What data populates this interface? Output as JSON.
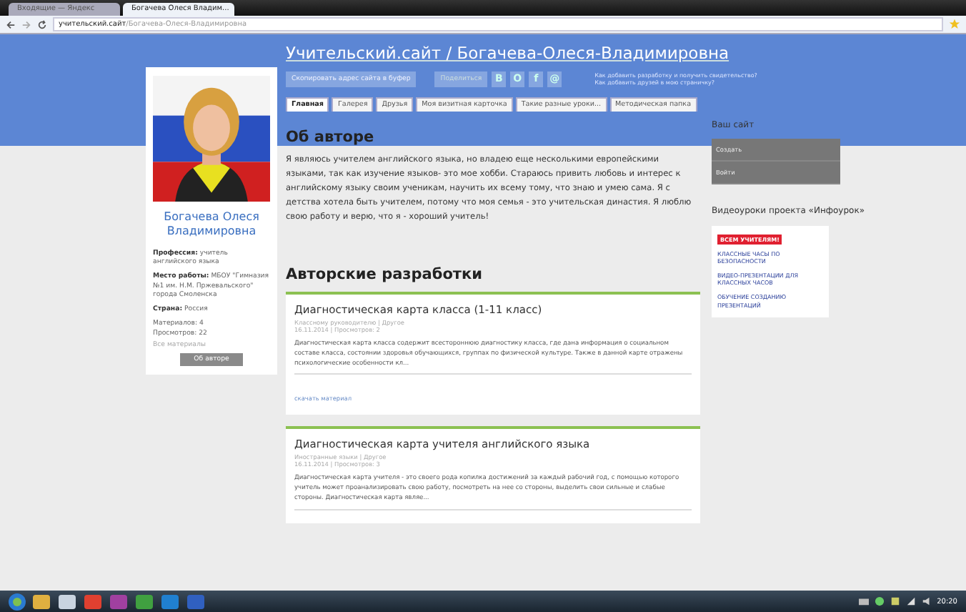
{
  "browser": {
    "tabs": [
      {
        "label": "Входящие — Яндекс",
        "selected": false
      },
      {
        "label": "Богачева Олеся Владим...",
        "selected": true
      }
    ],
    "url_host": "учительский.сайт",
    "url_path": "/Богачева-Олеся-Владимировна"
  },
  "header": {
    "title": "Учительский.сайт / Богачева-Олеся-Владимировна",
    "copy_button": "Скопировать адрес сайта в буфер",
    "share_label": "Поделиться",
    "share_buttons": [
      "В",
      "О",
      "f",
      "@"
    ],
    "help_links": [
      "Как добавить разработку и получить свидетельство?",
      "Как добавить друзей в мою страничку?"
    ],
    "nav": [
      {
        "label": "Главная",
        "selected": true
      },
      {
        "label": "Галерея",
        "selected": false
      },
      {
        "label": "Друзья",
        "selected": false
      },
      {
        "label": "Моя визитная карточка",
        "selected": false
      },
      {
        "label": "Такие разные уроки...",
        "selected": false
      },
      {
        "label": "Методическая папка",
        "selected": false
      }
    ]
  },
  "profile": {
    "name": "Богачева Олеся Владимировна",
    "fields": [
      {
        "label": "Профессия:",
        "value": "учитель английского языка"
      },
      {
        "label": "Место работы:",
        "value": "МБОУ \"Гимназия №1 им. Н.М. Пржевальского\" города Смоленска"
      },
      {
        "label": "Страна:",
        "value": "Россия"
      }
    ],
    "stats": [
      "Материалов: 4",
      "Просмотров: 22"
    ],
    "link": "Все материалы",
    "button": "Об авторе"
  },
  "about": {
    "heading": "Об авторе",
    "text": "Я являюсь учителем английского языка, но владею еще несколькими европейскими языками, так как изучение языков- это мое хобби. Стараюсь привить любовь и интерес к английскому языку своим ученикам, научить их всему тому, что знаю и умею сама. Я с детства хотела быть учителем, потому что моя семья - это учительская династия. Я люблю свою работу и верю, что я - хороший учитель!"
  },
  "works": {
    "heading": "Авторские разработки",
    "items": [
      {
        "title": "Диагностическая карта класса (1-11 класс)",
        "category": "Классному руководителю | Другое",
        "date": "16.11.2014 | Просмотров: 2",
        "text": "Диагностическая карта класса содержит всестороннюю диагностику класса, где дана информация о социальном составе класса, состоянии здоровья обучающихся, группах по физической культуре. Также в данной карте отражены психологические особенности кл...",
        "download": "скачать материал"
      },
      {
        "title": "Диагностическая карта учителя английского языка",
        "category": "Иностранные языки | Другое",
        "date": "16.11.2014 | Просмотров: 3",
        "text": "Диагностическая карта учителя - это своего рода копилка достижений за каждый рабочий год, с помощью которого учитель может проанализировать свою работу, посмотреть на нее со стороны, выделить свои сильные и слабые стороны. Диагностическая карта являе..."
      }
    ]
  },
  "sidebar": {
    "site_heading": "Ваш сайт",
    "site_menu": [
      "Создать",
      "Войти"
    ],
    "video_heading": "Видеоуроки проекта «Инфоурок»",
    "badge": "ВСЕМ УЧИТЕЛЯМ!",
    "video_links": [
      "КЛАССНЫЕ ЧАСЫ ПО БЕЗОПАСНОСТИ",
      "ВИДЕО-ПРЕЗЕНТАЦИИ ДЛЯ КЛАССНЫХ ЧАСОВ",
      "ОБУЧЕНИЕ СОЗДАНИЮ ПРЕЗЕНТАЦИЙ"
    ]
  },
  "taskbar": {
    "clock": "20:20"
  }
}
